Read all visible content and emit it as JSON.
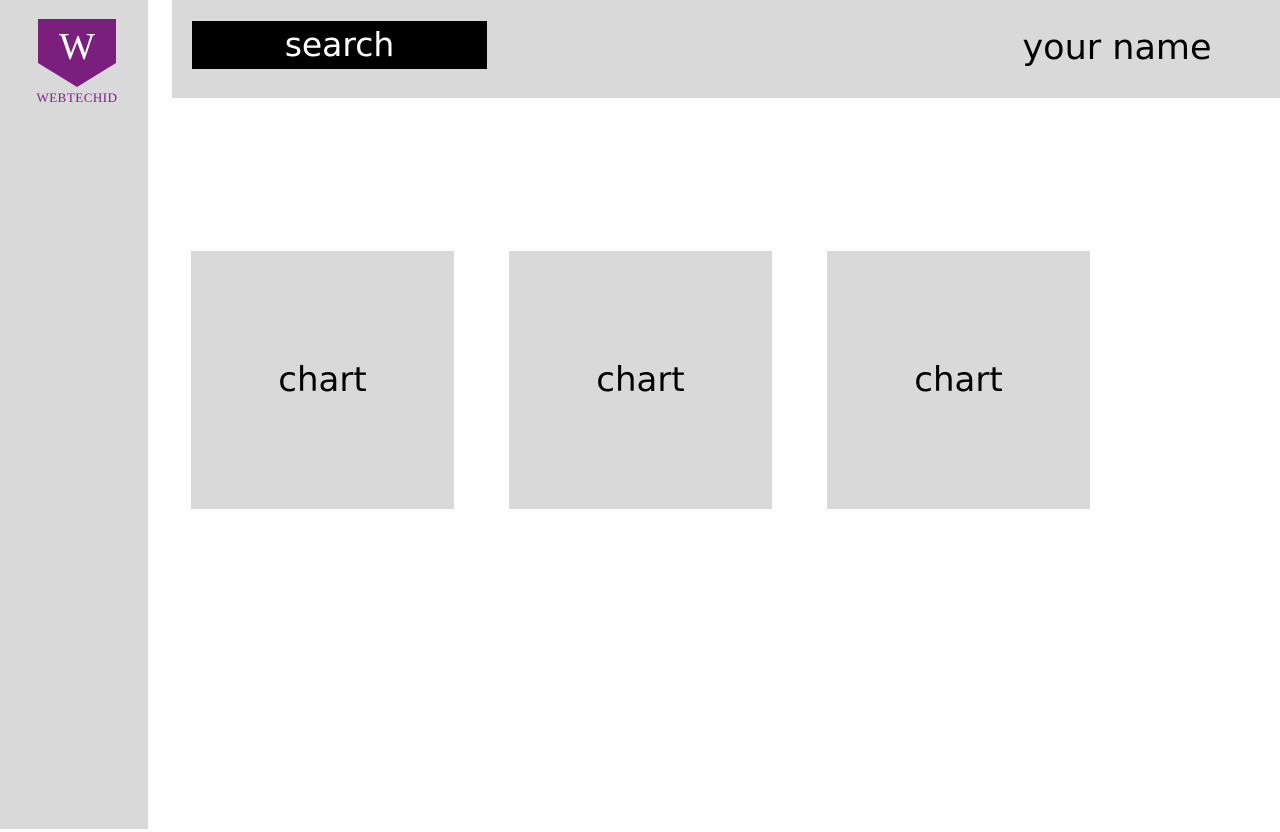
{
  "sidebar": {
    "logo": {
      "monogram": "W",
      "brand_name": "WEBTECHID",
      "color": "#7b1f7e"
    }
  },
  "header": {
    "search_label": "search",
    "user_name": "your name"
  },
  "main": {
    "charts": [
      {
        "label": "chart"
      },
      {
        "label": "chart"
      },
      {
        "label": "chart"
      }
    ]
  }
}
